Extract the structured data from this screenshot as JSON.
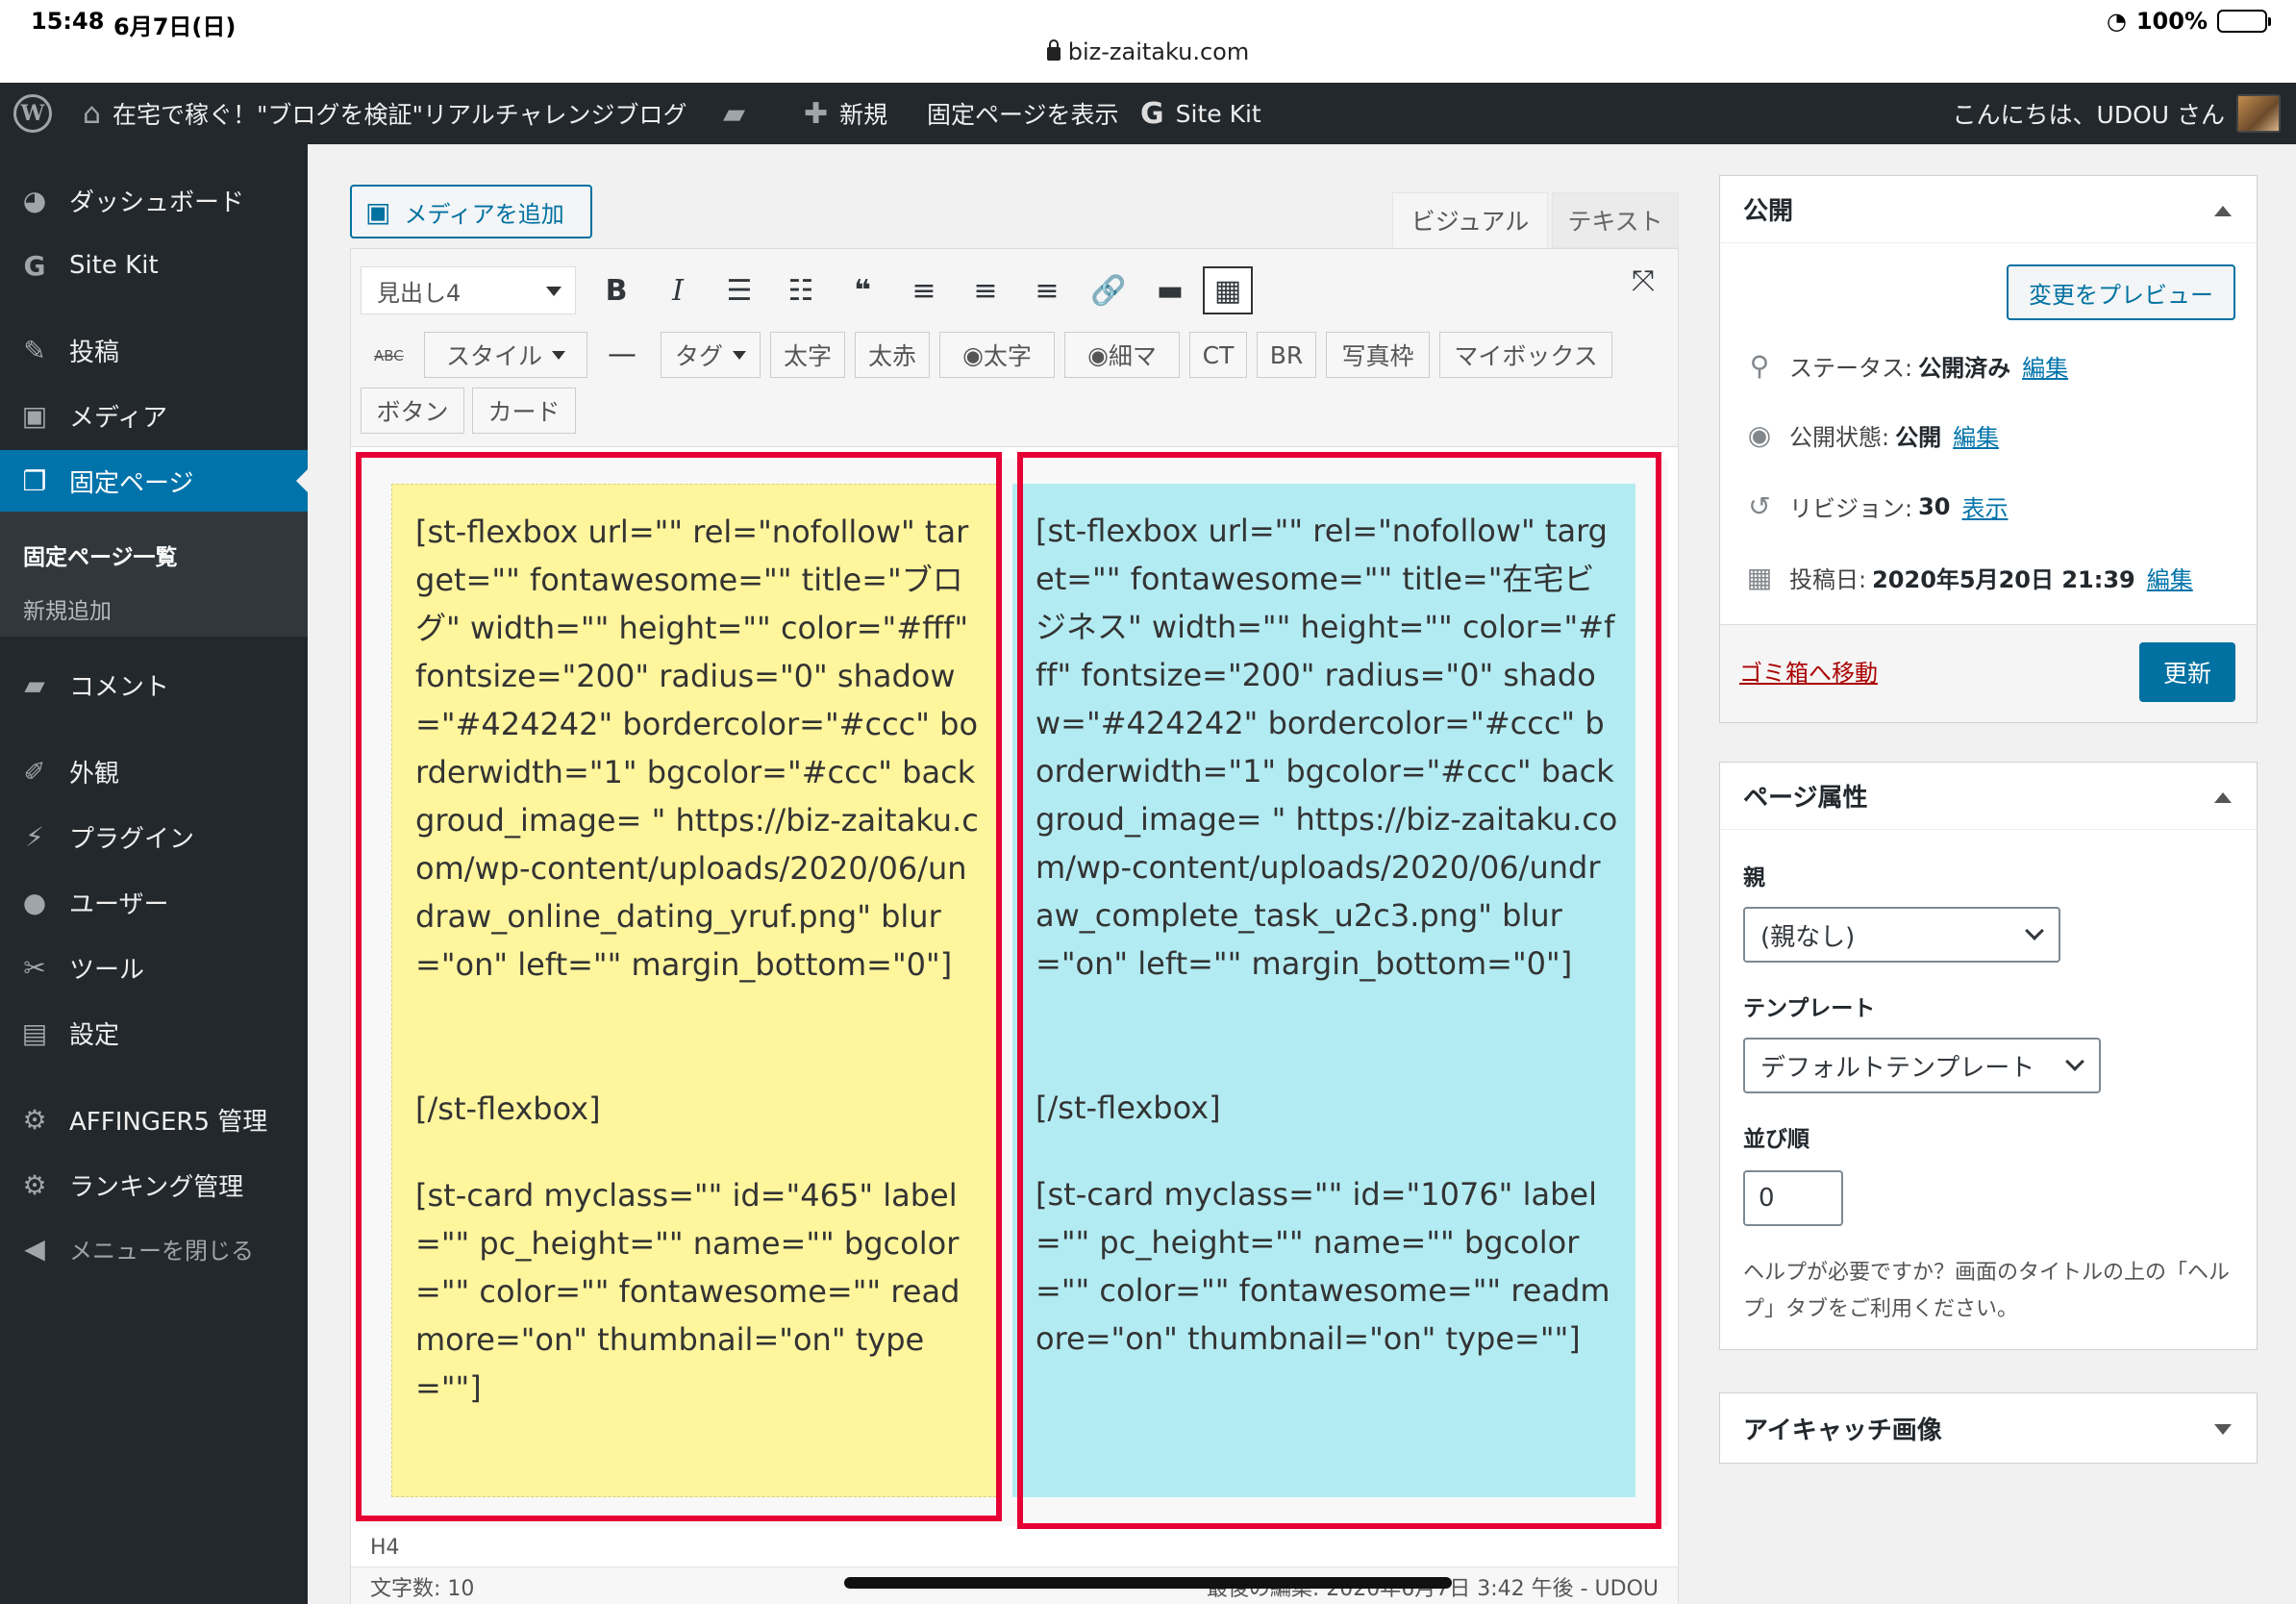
{
  "status_bar": {
    "time": "15:48",
    "date": "6月7日(日)",
    "battery": "100%",
    "url": "biz-zaitaku.com"
  },
  "adminbar": {
    "site_title": "在宅で稼ぐ！\"ブログを検証\"リアルチャレンジブログ",
    "new_label": "新規",
    "view_page": "固定ページを表示",
    "sitekit": "Site Kit",
    "greeting": "こんにちは、UDOU さん"
  },
  "sidebar": {
    "dashboard": "ダッシュボード",
    "sitekit": "Site Kit",
    "posts": "投稿",
    "media": "メディア",
    "pages": "固定ページ",
    "pages_list": "固定ページ一覧",
    "pages_new": "新規追加",
    "comments": "コメント",
    "appearance": "外観",
    "plugins": "プラグイン",
    "users": "ユーザー",
    "tools": "ツール",
    "settings": "設定",
    "affinger": "AFFINGER5 管理",
    "ranking": "ランキング管理",
    "collapse": "メニューを閉じる"
  },
  "editor": {
    "add_media": "メディアを追加",
    "tab_visual": "ビジュアル",
    "tab_text": "テキスト",
    "format_select": "見出し4",
    "strike_label": "ABC",
    "btn_style": "スタイル",
    "btn_tag": "タグ",
    "btn_bold": "太字",
    "btn_bold_red": "太赤",
    "btn_user_bold": "太字",
    "btn_user_thin": "細マ",
    "btn_ct": "CT",
    "btn_br": "BR",
    "btn_photo": "写真枠",
    "btn_mybox": "マイボックス",
    "btn_button": "ボタン",
    "btn_card": "カード",
    "left_flexbox": "[st-flexbox url=\"\" rel=\"nofollow\" target=\"\" fontawesome=\"\" title=\"ブログ\" width=\"\" height=\"\" color=\"#fff\" fontsize=\"200\" radius=\"0\" shadow=\"#424242\" bordercolor=\"#ccc\" borderwidth=\"1\" bgcolor=\"#ccc\" backgroud_image= \" https://biz-zaitaku.com/wp-content/uploads/2020/06/undraw_online_dating_yruf.png\" blur=\"on\" left=\"\" margin_bottom=\"0\"]",
    "left_close": "[/st-flexbox]",
    "left_card": "[st-card myclass=\"\" id=\"465\" label=\"\" pc_height=\"\" name=\"\" bgcolor=\"\" color=\"\" fontawesome=\"\" readmore=\"on\" thumbnail=\"on\" type=\"\"]",
    "right_flexbox": "[st-flexbox url=\"\" rel=\"nofollow\" target=\"\" fontawesome=\"\" title=\"在宅ビジネス\" width=\"\" height=\"\" color=\"#fff\" fontsize=\"200\" radius=\"0\" shadow=\"#424242\" bordercolor=\"#ccc\" borderwidth=\"1\" bgcolor=\"#ccc\" backgroud_image= \" https://biz-zaitaku.com/wp-content/uploads/2020/06/undraw_complete_task_u2c3.png\" blur=\"on\" left=\"\" margin_bottom=\"0\"]",
    "right_close": "[/st-flexbox]",
    "right_card": "[st-card myclass=\"\" id=\"1076\" label=\"\" pc_height=\"\" name=\"\" bgcolor=\"\" color=\"\" fontawesome=\"\" readmore=\"on\" thumbnail=\"on\" type=\"\"]",
    "path": "H4",
    "word_count": "文字数: 10",
    "last_edit": "最後の編集: 2020年6月7日 3:42 午後 - UDOU"
  },
  "publish": {
    "title": "公開",
    "preview": "変更をプレビュー",
    "status_label": "ステータス:",
    "status_value": "公開済み",
    "visibility_label": "公開状態:",
    "visibility_value": "公開",
    "revision_label": "リビジョン:",
    "revision_value": "30",
    "revision_link": "表示",
    "date_label": "投稿日:",
    "date_value": "2020年5月20日 21:39",
    "edit": "編集",
    "trash": "ゴミ箱へ移動",
    "update": "更新"
  },
  "attributes": {
    "title": "ページ属性",
    "parent_label": "親",
    "parent_value": "(親なし)",
    "template_label": "テンプレート",
    "template_value": "デフォルトテンプレート",
    "order_label": "並び順",
    "order_value": "0",
    "help": "ヘルプが必要ですか？画面のタイトルの上の「ヘルプ」タブをご利用ください。"
  },
  "thumbnail": {
    "title": "アイキャッチ画像"
  },
  "colors": {
    "accent": "#0073aa",
    "highlight_frame": "#e60033",
    "yellow_box": "#fff59d",
    "blue_box": "#b3ebf2",
    "admin_dark": "#23282d"
  }
}
